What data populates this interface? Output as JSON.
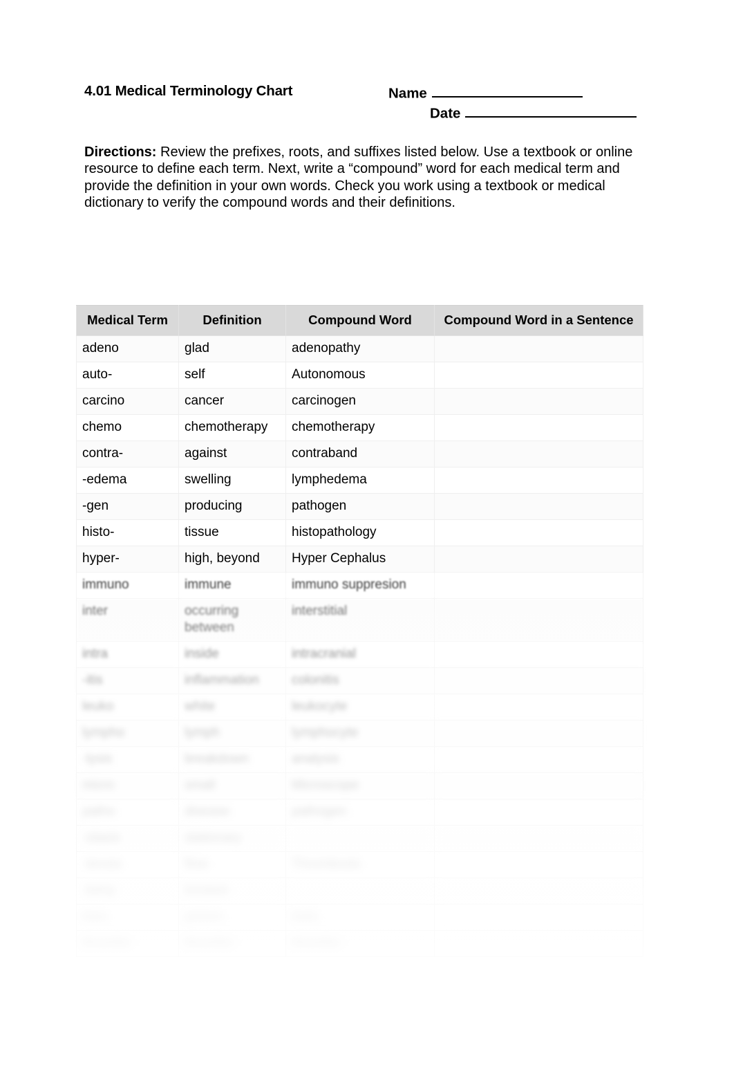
{
  "document": {
    "title": "4.01 Medical Terminology Chart",
    "name_label": "Name",
    "date_label": "Date",
    "directions_lead": "Directions:",
    "directions_body": " Review the prefixes, roots, and suffixes listed below. Use a textbook or online resource to define each term. Next, write a “compound” word for each medical term and provide the definition in your own words. Check you work using a textbook or medical dictionary to verify the compound words and their definitions."
  },
  "table": {
    "headers": [
      "Medical Term",
      "Definition",
      "Compound Word",
      "Compound Word in a Sentence"
    ],
    "header_bg": "#d9d9d9",
    "rows": [
      {
        "term": "adeno",
        "definition": "glad",
        "compound": "adenopathy",
        "sentence": "",
        "blur": 0
      },
      {
        "term": "auto-",
        "definition": "self",
        "compound": "Autonomous",
        "sentence": "",
        "blur": 0
      },
      {
        "term": "carcino",
        "definition": "cancer",
        "compound": "carcinogen",
        "sentence": "",
        "blur": 0
      },
      {
        "term": "chemo",
        "definition": "chemotherapy",
        "compound": "chemotherapy",
        "sentence": "",
        "blur": 0
      },
      {
        "term": "contra-",
        "definition": "against",
        "compound": "contraband",
        "sentence": "",
        "blur": 0
      },
      {
        "term": "-edema",
        "definition": "swelling",
        "compound": "lymphedema",
        "sentence": "",
        "blur": 0
      },
      {
        "term": "-gen",
        "definition": "producing",
        "compound": "pathogen",
        "sentence": "",
        "blur": 0
      },
      {
        "term": "histo-",
        "definition": "tissue",
        "compound": "histopathology",
        "sentence": "",
        "blur": 0
      },
      {
        "term": "hyper-",
        "definition": "high, beyond",
        "compound": "Hyper Cephalus",
        "sentence": "",
        "blur": 0
      },
      {
        "term": "immuno",
        "definition": "immune",
        "compound": "immuno suppresion",
        "sentence": "",
        "blur": 1
      },
      {
        "term": "inter",
        "definition": "occurring between",
        "compound": "interstitial",
        "sentence": "",
        "blur": 2
      },
      {
        "term": "intra",
        "definition": "inside",
        "compound": "intracranial",
        "sentence": "",
        "blur": 3
      },
      {
        "term": "-itis",
        "definition": "inflammation",
        "compound": "colonitis",
        "sentence": "",
        "blur": 4
      },
      {
        "term": "leuko",
        "definition": "white",
        "compound": "leukocyte",
        "sentence": "",
        "blur": 5
      },
      {
        "term": "lympho",
        "definition": "lymph",
        "compound": "lymphocyte",
        "sentence": "",
        "blur": 6
      },
      {
        "term": "-lysis",
        "definition": "breakdown",
        "compound": "analysis",
        "sentence": "",
        "blur": 7
      },
      {
        "term": "micro",
        "definition": "small",
        "compound": "Microscope",
        "sentence": "",
        "blur": 8
      },
      {
        "term": "patho",
        "definition": "disease",
        "compound": "pathogen",
        "sentence": "",
        "blur": 9
      },
      {
        "term": "-stasis",
        "definition": "stationary",
        "compound": "",
        "sentence": "",
        "blur": 10
      },
      {
        "term": "-tensio",
        "definition": "flow",
        "compound": "Thrombosis",
        "sentence": "",
        "blur": 11
      },
      {
        "term": "-tomy",
        "definition": "incision",
        "compound": "",
        "sentence": "",
        "blur": 11
      },
      {
        "term": "toxo",
        "definition": "poison",
        "compound": "toxic",
        "sentence": "",
        "blur": 12
      },
      {
        "term": "thrombo",
        "definition": "thrombo",
        "compound": "thrombo",
        "sentence": "",
        "blur": 12
      }
    ]
  }
}
